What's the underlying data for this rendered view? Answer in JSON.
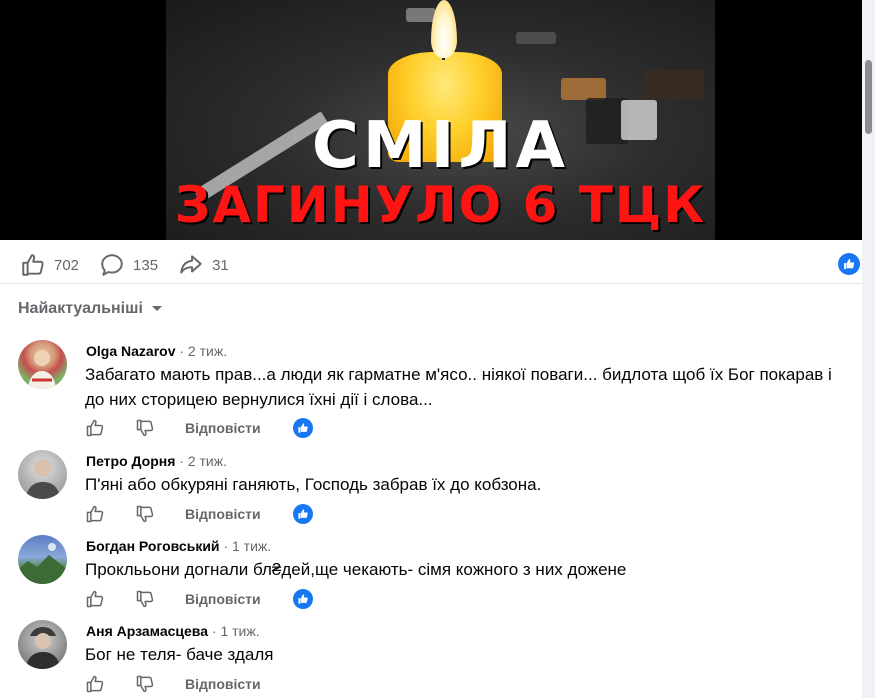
{
  "media": {
    "headline_line1": "СМІЛА",
    "headline_line2": "ЗАГИНУЛО 6 ТЦК"
  },
  "stats": {
    "likes": "702",
    "comments": "135",
    "shares": "31"
  },
  "sort": {
    "label": "Найактуальніші"
  },
  "comments": [
    {
      "name": "Olga Nazarov",
      "time": "· 2 тиж.",
      "text": "Забагато мають прав...а люди як гарматне м'ясо.. ніякої поваги... бидлота щоб їх Бог покарав і до них сторицею вернулися їхні дії і слова...",
      "reply": "Відповісти"
    },
    {
      "name": "Петро Дорня",
      "time": "· 2 тиж.",
      "text": "П'яні або обкуряні ганяють, Господь забрав їх до кобзона.",
      "reply": "Відповісти"
    },
    {
      "name": "Богдан Роговський",
      "time": "· 1 тиж.",
      "text": "Проклььони догнали бл₴дей,ще чекають- сімя кожного з них дожене",
      "reply": "Відповісти"
    },
    {
      "name": "Аня Арзамасцева",
      "time": "· 1 тиж.",
      "text": "Бог не теля- баче здаля",
      "reply": "Відповісти"
    }
  ],
  "colors": {
    "facebook_blue": "#1877f2",
    "secondary_text": "#65676b",
    "headline_red": "#ff1414"
  }
}
